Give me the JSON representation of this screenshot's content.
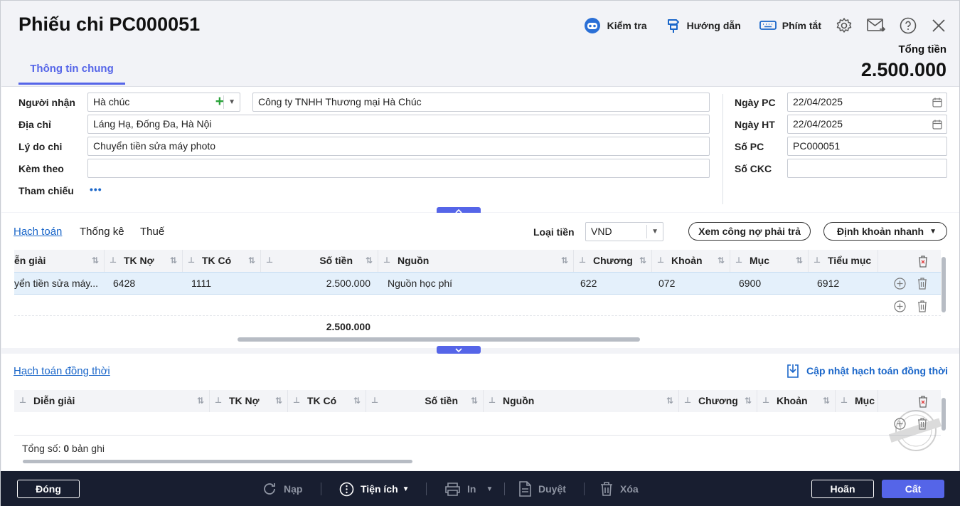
{
  "header": {
    "title": "Phiếu chi PC000051",
    "actions": {
      "check": "Kiểm tra",
      "guide": "Hướng dẫn",
      "shortcut": "Phím tắt"
    },
    "total_label": "Tổng tiền",
    "total_value": "2.500.000",
    "tab_general": "Thông tin chung"
  },
  "form": {
    "recipient_label": "Người nhận",
    "recipient_value": "Hà chúc",
    "company_value": "Công ty TNHH Thương mại Hà Chúc",
    "address_label": "Địa chỉ",
    "address_value": "Láng Hạ, Đống Đa, Hà Nội",
    "reason_label": "Lý do chi",
    "reason_value": "Chuyển tiền sửa máy photo",
    "attach_label": "Kèm theo",
    "attach_value": "",
    "reference_label": "Tham chiếu",
    "reference_more": "•••",
    "date_pc_label": "Ngày PC",
    "date_pc_value": "22/04/2025",
    "date_ht_label": "Ngày HT",
    "date_ht_value": "22/04/2025",
    "so_pc_label": "Số PC",
    "so_pc_value": "PC000051",
    "so_ckc_label": "Số CKC",
    "so_ckc_value": ""
  },
  "accounting": {
    "tabs": [
      "Hạch toán",
      "Thống kê",
      "Thuế"
    ],
    "currency_label": "Loại tiền",
    "currency_value": "VND",
    "view_debt_button": "Xem công nợ phải trả",
    "quick_entry_button": "Định khoản nhanh",
    "columns": [
      "ễn giải",
      "TK Nợ",
      "TK Có",
      "Số tiền",
      "Nguồn",
      "Chương",
      "Khoản",
      "Mục",
      "Tiểu mục"
    ],
    "row": [
      "yển tiền sửa máy...",
      "6428",
      "1111",
      "2.500.000",
      "Nguồn học phí",
      "622",
      "072",
      "6900",
      "6912"
    ],
    "sum": "2.500.000"
  },
  "concurrent": {
    "title": "Hạch toán đồng thời",
    "update_button": "Cập nhật hạch toán đồng thời",
    "columns": [
      "Diễn giải",
      "TK Nợ",
      "TK Có",
      "Số tiền",
      "Nguồn",
      "Chương",
      "Khoản",
      "Mục"
    ],
    "total_prefix": "Tổng số: ",
    "total_count": "0",
    "total_suffix": " bản ghi"
  },
  "footer": {
    "close": "Đóng",
    "reload": "Nạp",
    "utilities": "Tiện ích",
    "print": "In",
    "approve": "Duyệt",
    "delete": "Xóa",
    "cancel": "Hoãn",
    "save": "Cất"
  },
  "colors": {
    "accent": "#5565e8",
    "link": "#1a66c9",
    "footer_bg": "#181e30"
  }
}
